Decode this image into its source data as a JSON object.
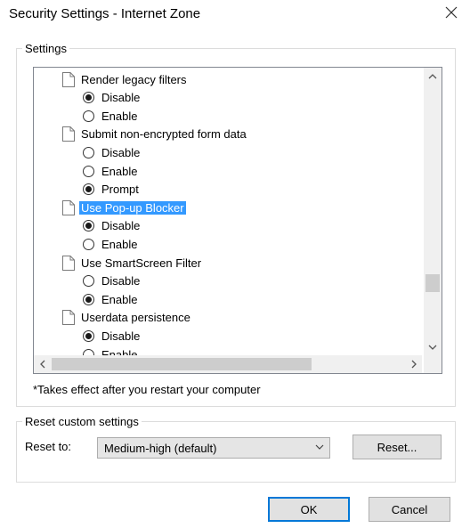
{
  "window": {
    "title": "Security Settings - Internet Zone"
  },
  "settings_group": {
    "label": "Settings",
    "items": [
      {
        "kind": "category",
        "label": "Render legacy filters"
      },
      {
        "kind": "option",
        "label": "Disable",
        "checked": true
      },
      {
        "kind": "option",
        "label": "Enable",
        "checked": false
      },
      {
        "kind": "category",
        "label": "Submit non-encrypted form data"
      },
      {
        "kind": "option",
        "label": "Disable",
        "checked": false
      },
      {
        "kind": "option",
        "label": "Enable",
        "checked": false
      },
      {
        "kind": "option",
        "label": "Prompt",
        "checked": true
      },
      {
        "kind": "category",
        "label": "Use Pop-up Blocker",
        "selected": true
      },
      {
        "kind": "option",
        "label": "Disable",
        "checked": true
      },
      {
        "kind": "option",
        "label": "Enable",
        "checked": false
      },
      {
        "kind": "category",
        "label": "Use SmartScreen Filter"
      },
      {
        "kind": "option",
        "label": "Disable",
        "checked": false
      },
      {
        "kind": "option",
        "label": "Enable",
        "checked": true
      },
      {
        "kind": "category",
        "label": "Userdata persistence"
      },
      {
        "kind": "option",
        "label": "Disable",
        "checked": true
      },
      {
        "kind": "option",
        "label": "Enable",
        "checked": false
      }
    ],
    "note": "*Takes effect after you restart your computer"
  },
  "reset_group": {
    "label": "Reset custom settings",
    "reset_to_label": "Reset to:",
    "selected_level": "Medium-high (default)",
    "reset_button": "Reset..."
  },
  "footer": {
    "ok_button": "OK",
    "cancel_button": "Cancel"
  },
  "colors": {
    "selection": "#3399ff",
    "default_button_border": "#0078d7"
  }
}
